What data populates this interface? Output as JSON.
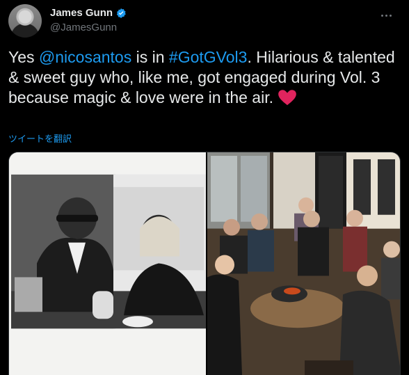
{
  "tweet": {
    "author_name": "James Gunn",
    "author_handle": "@JamesGunn",
    "text_parts": {
      "t1": "Yes ",
      "mention": "@nicosantos",
      "t2": " is in ",
      "hashtag": "#GotGVol3",
      "t3": ". Hilarious & talented & sweet guy who, like me, got engaged during Vol. 3 because magic & love were in the air. "
    },
    "translate_label": "ツイートを翻訳"
  },
  "colors": {
    "background": "#000000",
    "link": "#1d9bf0",
    "verified": "#1d9bf0",
    "heart": "#e0245e"
  },
  "icons": [
    "avatar",
    "verified-badge-icon",
    "more-options-icon",
    "red-heart-emoji"
  ]
}
